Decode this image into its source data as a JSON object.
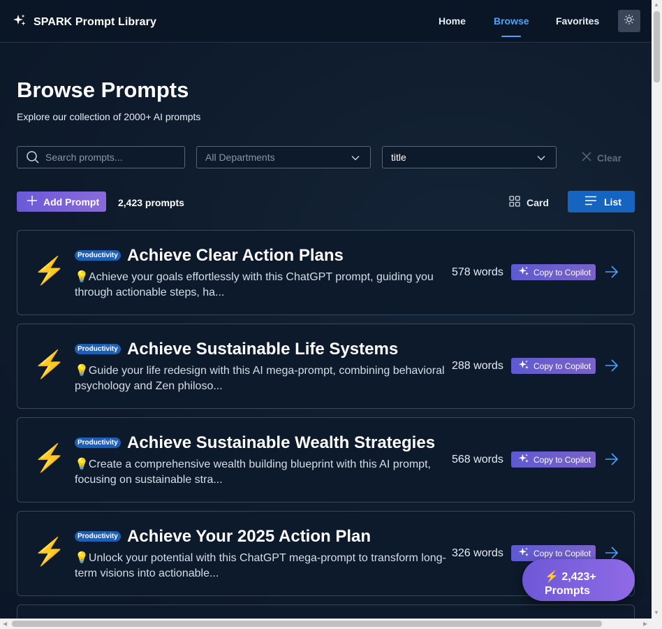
{
  "app": {
    "title": "SPARK Prompt Library"
  },
  "nav": {
    "home": "Home",
    "browse": "Browse",
    "favorites": "Favorites",
    "active": "Browse"
  },
  "hero": {
    "title": "Browse Prompts",
    "subtitle": "Explore our collection of 2000+ AI prompts"
  },
  "filters": {
    "search_placeholder": "Search prompts...",
    "search_value": "",
    "department": "All Departments",
    "sort": "title",
    "clear_label": "Clear"
  },
  "toolbar": {
    "add_label": "Add Prompt",
    "count": "2,423 prompts",
    "view_card": "Card",
    "view_list": "List",
    "active_view": "List"
  },
  "prompts": [
    {
      "icon": "⚡",
      "badge": "Productivity",
      "title": "Achieve Clear Action Plans",
      "description": "💡Achieve your goals effortlessly with this ChatGPT prompt, guiding you through actionable steps, ha...",
      "words": "578 words",
      "copy_label": "Copy to Copilot"
    },
    {
      "icon": "⚡",
      "badge": "Productivity",
      "title": "Achieve Sustainable Life Systems",
      "description": "💡Guide your life redesign with this AI mega-prompt, combining behavioral psychology and Zen philoso...",
      "words": "288 words",
      "copy_label": "Copy to Copilot"
    },
    {
      "icon": "⚡",
      "badge": "Productivity",
      "title": "Achieve Sustainable Wealth Strategies",
      "description": "💡Create a comprehensive wealth building blueprint with this AI prompt, focusing on sustainable stra...",
      "words": "568 words",
      "copy_label": "Copy to Copilot"
    },
    {
      "icon": "⚡",
      "badge": "Productivity",
      "title": "Achieve Your 2025 Action Plan",
      "description": "💡Unlock your potential with this ChatGPT mega-prompt to transform long-term visions into actionable...",
      "words": "326 words",
      "copy_label": "Copy to Copilot"
    }
  ],
  "fab": {
    "label": "⚡ 2,423+ Prompts"
  },
  "colors": {
    "accent": "#4aa3ff",
    "primary": "#1565c0",
    "purple": "#7a62c8",
    "background": "#0d1a2b"
  }
}
